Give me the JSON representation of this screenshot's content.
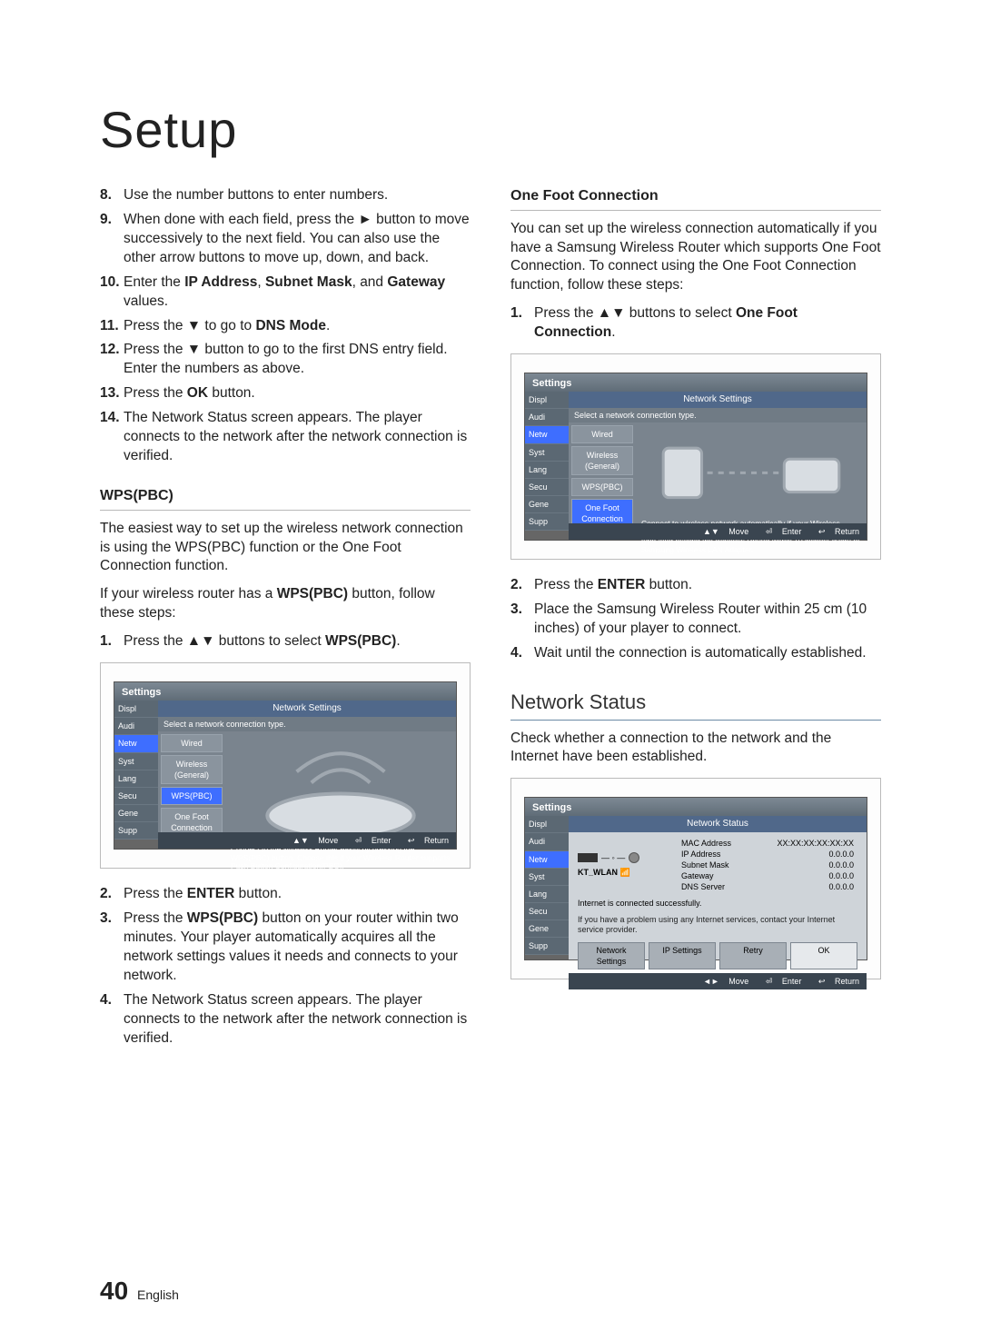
{
  "page_title": "Setup",
  "footer": {
    "page_num": "40",
    "lang": "English"
  },
  "left": {
    "steps_cont": [
      {
        "n": "8.",
        "html": "Use the number buttons to enter numbers."
      },
      {
        "n": "9.",
        "html": "When done with each field, press the ► button to move successively to the next field. You can also use the other arrow buttons to move up, down, and back."
      },
      {
        "n": "10.",
        "pre": "Enter the ",
        "b1": "IP Address",
        "mid1": ", ",
        "b2": "Subnet Mask",
        "mid2": ", and ",
        "b3": "Gateway",
        "post": " values."
      },
      {
        "n": "11.",
        "pre": "Press the ▼ to go to ",
        "b1": "DNS Mode",
        "post": "."
      },
      {
        "n": "12.",
        "html": "Press the ▼ button to go to the first DNS entry field. Enter the numbers as above."
      },
      {
        "n": "13.",
        "pre": "Press the ",
        "b1": "OK",
        "post": " button."
      },
      {
        "n": "14.",
        "html": "The Network Status screen appears. The player connects to the network after the network connection is verified."
      }
    ],
    "wps_head": "WPS(PBC)",
    "wps_intro": "The easiest way to set up the wireless network connection is using the WPS(PBC) function or the One Foot Connection function.",
    "wps_intro2_pre": "If your wireless router has a ",
    "wps_intro2_b": "WPS(PBC)",
    "wps_intro2_post": " button, follow these steps:",
    "wps_step1_pre": "Press the ▲▼ buttons to select ",
    "wps_step1_b": "WPS(PBC)",
    "wps_step1_post": ".",
    "wps_after": [
      {
        "n": "2.",
        "pre": "Press the ",
        "b1": "ENTER",
        "post": " button."
      },
      {
        "n": "3.",
        "pre": "Press the ",
        "b1": "WPS(PBC)",
        "post": " button on your router within two minutes. Your player automatically acquires all the network settings values it needs and connects to your network."
      },
      {
        "n": "4.",
        "html": "The Network Status screen appears. The player connects to the network after the network connection is verified."
      }
    ]
  },
  "right": {
    "ofc_head": "One Foot Connection",
    "ofc_intro": "You can set up the wireless connection automatically if you have a Samsung Wireless Router which supports One Foot Connection. To connect using the One Foot Connection function, follow these steps:",
    "ofc_step1_pre": "Press the ▲▼ buttons to select ",
    "ofc_step1_b": "One Foot Connection",
    "ofc_step1_post": ".",
    "ofc_after": [
      {
        "n": "2.",
        "pre": "Press the ",
        "b1": "ENTER",
        "post": " button."
      },
      {
        "n": "3.",
        "html": "Place the Samsung Wireless Router within 25 cm (10 inches) of your player to connect."
      },
      {
        "n": "4.",
        "html": "Wait until the connection is automatically established."
      }
    ],
    "ns_head": "Network Status",
    "ns_intro": "Check whether a connection to the network and the Internet have been established."
  },
  "shot_settings": {
    "title": "Settings",
    "panel_title": "Network Settings",
    "subtitle": "Select a network connection type.",
    "bar": {
      "move": "Move",
      "enter": "Enter",
      "return": "Return",
      "move_glyph": "▲▼",
      "enter_glyph": "⏎",
      "return_glyph": "↩"
    },
    "side_items": [
      "Displ",
      "Audi",
      "Netw",
      "Syst",
      "Lang",
      "Secu",
      "Gene",
      "Supp"
    ],
    "side_sel_idx": 2,
    "options": [
      "Wired",
      "Wireless (General)",
      "WPS(PBC)",
      "One Foot Connection"
    ]
  },
  "shot_wps": {
    "sel_idx": 2,
    "desc": "Connect to the Wireless Router easily by pressing the WPS(PBC) button. Choose this if your Wireless Router supports Push Button Configuration(PBC)."
  },
  "shot_ofc": {
    "sel_idx": 3,
    "desc": "Connect to wireless network automatically if your Wireless Router supports One Foot Connection. Select this connection type after placing the Wireless Router within 10 inches(25cm) of Samsung Wireless LAN Adapter."
  },
  "shot_status": {
    "title": "Settings",
    "panel_title": "Network Status",
    "net_name": "KT_WLAN",
    "rows": [
      [
        "MAC Address",
        "XX:XX:XX:XX:XX:XX"
      ],
      [
        "IP Address",
        "0.0.0.0"
      ],
      [
        "Subnet Mask",
        "0.0.0.0"
      ],
      [
        "Gateway",
        "0.0.0.0"
      ],
      [
        "DNS Server",
        "0.0.0.0"
      ]
    ],
    "msg1": "Internet is connected successfully.",
    "msg2": "If you have a problem using any Internet services, contact your Internet service provider.",
    "buttons": [
      "Network Settings",
      "IP Settings",
      "Retry",
      "OK"
    ],
    "bar": {
      "move_glyph": "◄►",
      "move": "Move",
      "enter_glyph": "⏎",
      "enter": "Enter",
      "return_glyph": "↩",
      "return": "Return"
    }
  }
}
